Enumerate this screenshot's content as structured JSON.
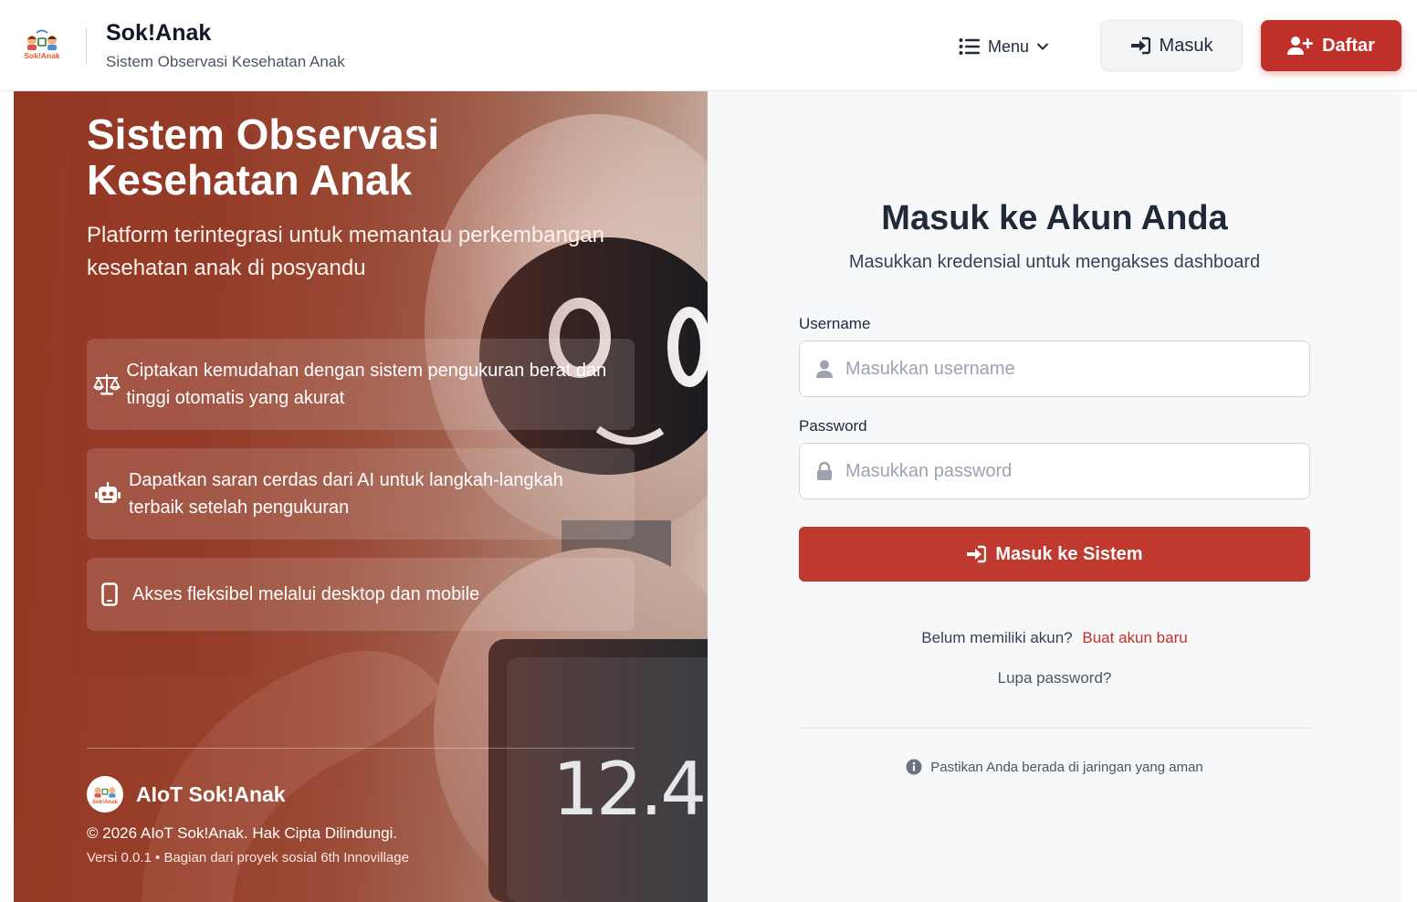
{
  "header": {
    "brand_title": "Sok!Anak",
    "brand_subtitle": "Sistem Observasi Kesehatan Anak",
    "menu_label": "Menu",
    "login_label": "Masuk",
    "register_label": "Daftar"
  },
  "hero": {
    "title": "Sistem Observasi Kesehatan Anak",
    "subtitle": "Platform terintegrasi untuk memantau perkembangan kesehatan anak di posyandu",
    "features": [
      {
        "icon": "scale-icon",
        "text": "Ciptakan kemudahan dengan sistem pengukuran berat dan tinggi otomatis yang akurat"
      },
      {
        "icon": "robot-icon",
        "text": "Dapatkan saran cerdas dari AI untuk langkah-langkah terbaik setelah pengukuran"
      },
      {
        "icon": "mobile-icon",
        "text": "Akses fleksibel melalui desktop dan mobile"
      }
    ],
    "display_reading": "12.4",
    "footer_brand": "AIoT Sok!Anak",
    "copyright": "© 2026 AIoT Sok!Anak. Hak Cipta Dilindungi.",
    "version": "Versi 0.0.1 • Bagian dari proyek sosial 6th Innovillage"
  },
  "login": {
    "title": "Masuk ke Akun Anda",
    "subtitle": "Masukkan kredensial untuk mengakses dashboard",
    "username_label": "Username",
    "username_placeholder": "Masukkan username",
    "password_label": "Password",
    "password_placeholder": "Masukkan password",
    "submit_label": "Masuk ke Sistem",
    "register_prompt": "Belum memiliki akun?",
    "register_link": "Buat akun baru",
    "forgot_link": "Lupa password?",
    "secure_note": "Pastikan Anda berada di jaringan yang aman"
  },
  "colors": {
    "accent": "#c0302a",
    "hero_overlay": "#963723",
    "page_bg": "#f7f8fa"
  }
}
